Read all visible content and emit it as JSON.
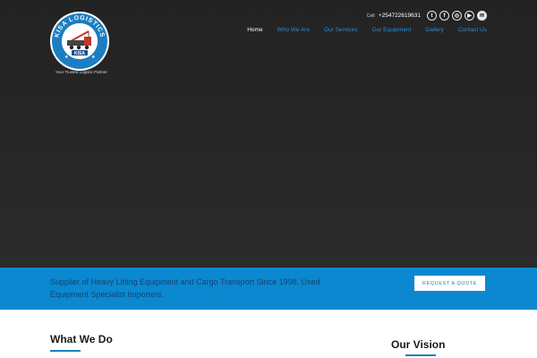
{
  "brand": {
    "logo_text": "KISA LOGISTICS",
    "logo_badge": "KISA",
    "tagline": "Your Trusted Logistic Partner"
  },
  "topbar": {
    "cell_label": "Cell:",
    "phone": "+254722619631",
    "social": [
      {
        "icon": "twitter-icon",
        "glyph": "t"
      },
      {
        "icon": "facebook-icon",
        "glyph": "f"
      },
      {
        "icon": "instagram-icon",
        "glyph": "◎"
      },
      {
        "icon": "youtube-icon",
        "glyph": "▶"
      },
      {
        "icon": "email-icon",
        "glyph": "✉"
      }
    ]
  },
  "nav": {
    "items": [
      {
        "label": "Home",
        "active": true
      },
      {
        "label": "Who We Are",
        "active": false
      },
      {
        "label": "Our Services",
        "active": false
      },
      {
        "label": "Our Equipment",
        "active": false
      },
      {
        "label": "Gallery",
        "active": false
      },
      {
        "label": "Contact Us",
        "active": false
      }
    ]
  },
  "banner": {
    "text": "Supplier of Heavy Lifting Equipment and Cargo Transport Since 1998. Used Equipment Specialist Importers.",
    "button": "Request a Quote"
  },
  "sections": {
    "what_we_do": "What We Do",
    "our_vision": "Our Vision"
  },
  "colors": {
    "accent": "#1b7ec1",
    "banner": "#0b88cf",
    "hero": "#262626"
  }
}
